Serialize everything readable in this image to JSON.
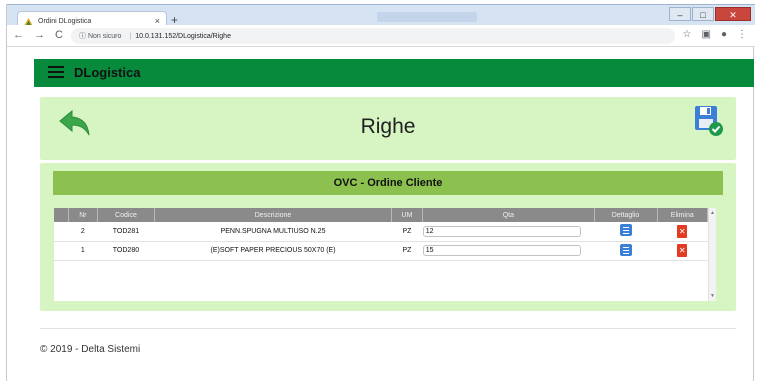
{
  "browser": {
    "tab_title": "Ordini DLogistica",
    "tab_close": "×",
    "new_tab": "+",
    "security": "ⓘ Non sicuro",
    "url": "10.0.131.152/DLogistica/Righe",
    "win_minimize": "–",
    "win_maximize": "□",
    "win_close": "✕"
  },
  "app": {
    "brand": "DLogistica",
    "page_title": "Righe",
    "section_title": "OVC - Ordine Cliente",
    "footer": "© 2019 - Delta Sistemi"
  },
  "table": {
    "headers": [
      "Nr",
      "Codice",
      "Descrizione",
      "UM",
      "Qta",
      "Dettaglio",
      "Elimina"
    ],
    "rows": [
      {
        "nr": "2",
        "codice": "TOD281",
        "descrizione": "PENN.SPUGNA MULTIUSO N.25",
        "um": "PZ",
        "qta": "12"
      },
      {
        "nr": "1",
        "codice": "TOD280",
        "descrizione": "(E)SOFT PAPER PRECIOUS 50X70 (E)",
        "um": "PZ",
        "qta": "15"
      }
    ]
  },
  "icons": {
    "back": "back-arrow-icon",
    "save": "save-disk-icon",
    "detail": "list-detail-icon",
    "delete": "delete-icon"
  },
  "colors": {
    "appbar": "#078a3c",
    "panel": "#d6f5c3",
    "section": "#8cc14f",
    "table_header": "#8a8a8a",
    "detail_icon": "#3b7fd6",
    "delete_icon": "#e33a22"
  }
}
